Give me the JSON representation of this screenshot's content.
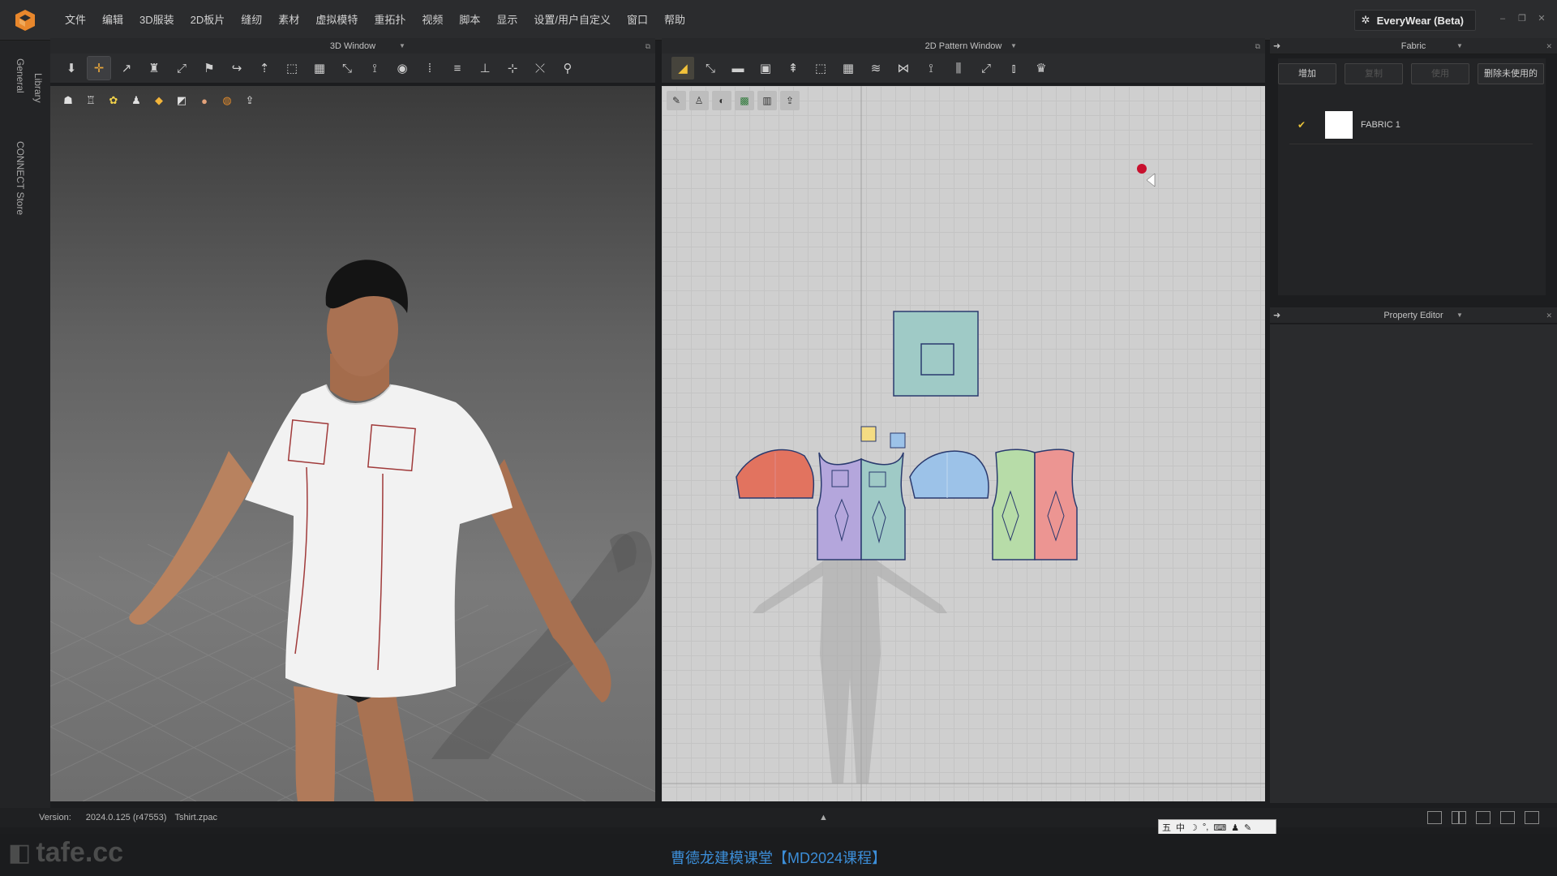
{
  "menu": {
    "items": [
      "文件",
      "编辑",
      "3D服装",
      "2D板片",
      "缝纫",
      "素材",
      "虚拟模特",
      "重拓扑",
      "视频",
      "脚本",
      "显示",
      "设置/用户自定义",
      "窗口",
      "帮助"
    ],
    "everywear_label": "EveryWear (Beta)"
  },
  "vtabs": {
    "library": "Library",
    "general": "General",
    "connect": "CONNECT Store"
  },
  "window3d": {
    "title": "3D Window"
  },
  "window2d": {
    "title": "2D Pattern Window"
  },
  "fabric": {
    "title": "Fabric",
    "buttons": {
      "add": "增加",
      "copy": "复制",
      "apply": "使用",
      "delete_unused": "删除未使用的"
    },
    "items": [
      {
        "name": "FABRIC 1"
      }
    ]
  },
  "property_editor": {
    "title": "Property Editor"
  },
  "status": {
    "version_label": "Version:",
    "version_value": "2024.0.125 (r47553)",
    "file": "Tshirt.zpac"
  },
  "caption": "曹德龙建模课堂【MD2024课程】",
  "watermark": "tafe.cc",
  "ime": {
    "lang": "中"
  },
  "colors": {
    "accent": "#e8a63c",
    "pattern_red": "#e2735f",
    "pattern_blue": "#9cc2e8",
    "pattern_purple": "#b4a6dc",
    "pattern_teal": "#9fcac6",
    "pattern_green": "#b7dca8",
    "pattern_pink": "#ec9592",
    "pattern_yellow": "#f4dc83"
  }
}
